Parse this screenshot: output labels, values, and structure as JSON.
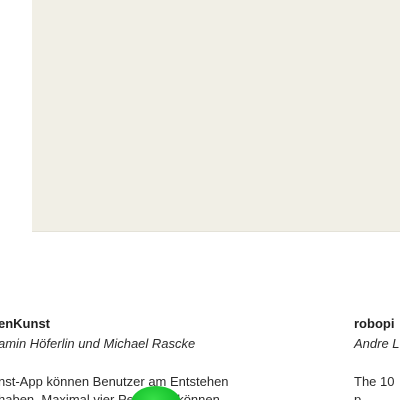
{
  "colors": {
    "canvas_background": "#f1efe6",
    "text": "#2b2b2b",
    "cursor": "#19c52f"
  },
  "cards": [
    {
      "title": "enKunst",
      "authors": "amin Höferlin und Michael Rascke",
      "description": [
        "nst-App können Benutzer am Entstehen",
        "haben. Maximal vier Personen können"
      ]
    },
    {
      "title": "robopi",
      "authors": "Andre L",
      "description": [
        "The 10",
        "p"
      ]
    }
  ]
}
